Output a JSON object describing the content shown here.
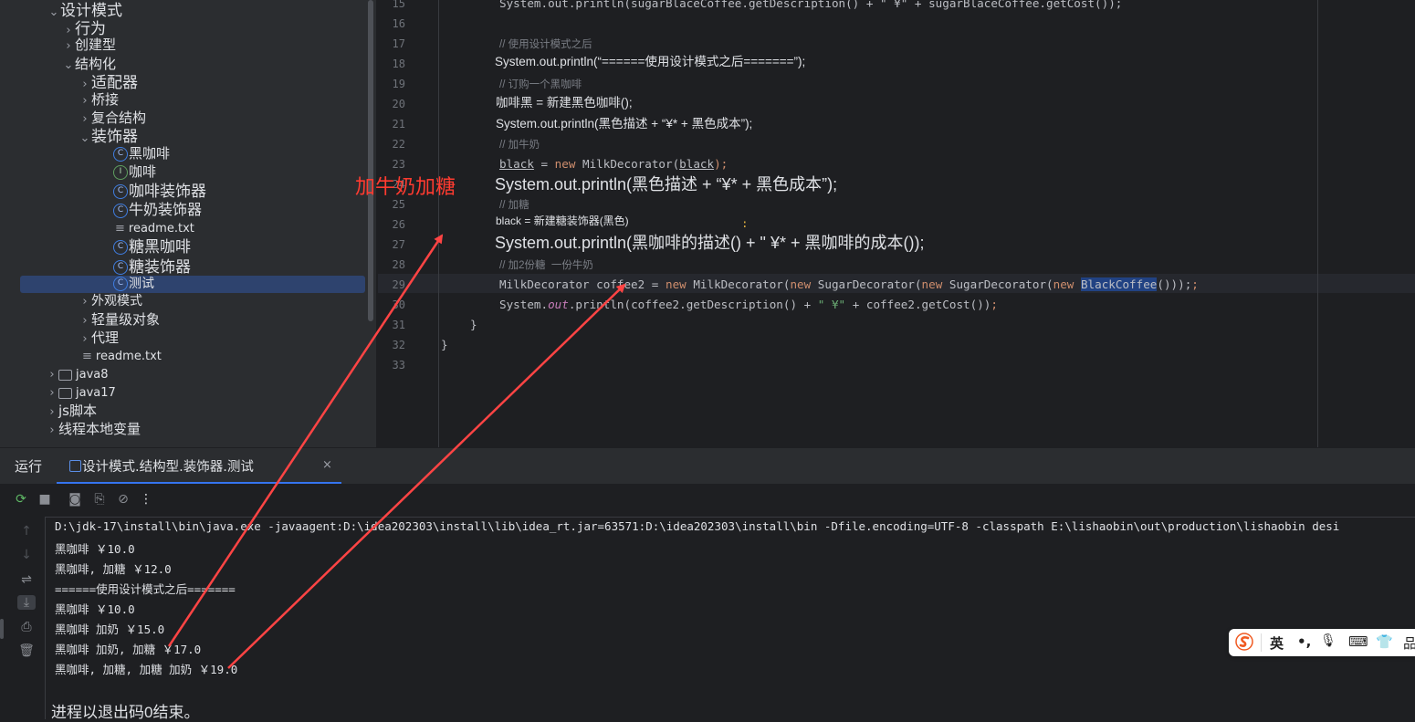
{
  "tree": {
    "items": [
      {
        "label": "设计模式",
        "chev": "⌄"
      },
      {
        "label": "行为",
        "chev": "›"
      },
      {
        "label": "创建型",
        "chev": "›"
      },
      {
        "label": "结构化",
        "chev": "⌄"
      },
      {
        "label": "适配器",
        "chev": "›"
      },
      {
        "label": "桥接",
        "chev": "›"
      },
      {
        "label": "复合结构",
        "chev": "›"
      },
      {
        "label": "装饰器",
        "chev": "⌄"
      },
      {
        "label": "黑咖啡",
        "icon": "class-icon"
      },
      {
        "label": "咖啡",
        "icon": "interface-icon"
      },
      {
        "label": "咖啡装饰器",
        "icon": "class-icon"
      },
      {
        "label": "牛奶装饰器",
        "icon": "class-icon"
      },
      {
        "label": "readme.txt",
        "icon": "text-file-icon"
      },
      {
        "label": "糖黑咖啡",
        "icon": "class-icon"
      },
      {
        "label": "糖装饰器",
        "icon": "class-icon"
      },
      {
        "label": "测试",
        "icon": "class-icon"
      },
      {
        "label": "外观模式",
        "chev": "›"
      },
      {
        "label": "轻量级对象",
        "chev": "›"
      },
      {
        "label": "代理",
        "chev": "›"
      },
      {
        "label": "readme.txt",
        "icon": "text-file-icon"
      },
      {
        "label": "java8",
        "chev": "›"
      },
      {
        "label": "java17",
        "chev": "›"
      },
      {
        "label": "js脚本",
        "chev": "›"
      },
      {
        "label": "线程本地变量",
        "chev": "›"
      }
    ],
    "class_glyph": "C",
    "interface_glyph": "I"
  },
  "editor": {
    "line_numbers": [
      "15",
      "16",
      "17",
      "18",
      "19",
      "20",
      "21",
      "22",
      "23",
      "24",
      "25",
      "26",
      "27",
      "28",
      "29",
      "30",
      "31",
      "32",
      "33"
    ],
    "line15": "System.out.println(sugarBlaceCoffee.getDescription() + \" ¥\" + sugarBlaceCoffee.getCost());",
    "line17": "// 使用设计模式之后",
    "line18": "System.out.println(“======使用设计模式之后=======”);",
    "line19": "// 订购一个黑咖啡",
    "line20": "咖啡黑 = 新建黑色咖啡();",
    "line21": "System.out.println(黑色描述 + “¥* + 黑色成本”);",
    "line22": "// 加牛奶",
    "line23_var": "black",
    "line23_eq": " = ",
    "line23_new": "new",
    "line23_cls": " MilkDecorator(",
    "line23_arg": "black",
    "line23_end": ");",
    "line24": "System.out.println(黑色描述 + “¥* + 黑色成本”);",
    "line25": "// 加糖",
    "line26": "black = 新建糖装饰器(黑色)",
    "line26_mark": ":",
    "line27": "System.out.println(黑咖啡的描述() + \" ¥* + 黑咖啡的成本());",
    "line28": "// 加2份糖  一份牛奶",
    "line29_a": "MilkDecorator coffee2 = ",
    "line29_new1": "new",
    "line29_b": " MilkDecorator(",
    "line29_new2": "new",
    "line29_c": " SugarDecorator(",
    "line29_new3": "new",
    "line29_d": " SugarDecorator(",
    "line29_new4": "new",
    "line29_sel": "BlackCoffee",
    "line29_end": "()));",
    "line29_semi": ";",
    "line30_a": "System.",
    "line30_out": "out",
    "line30_b": ".println(coffee2.getDescription() + ",
    "line30_str": "\" ¥\"",
    "line30_c": " + coffee2.getCost())",
    "line30_semi": ";",
    "line31": "}",
    "line32": "}"
  },
  "annotation": "加牛奶加糖",
  "run": {
    "label": "运行",
    "tab": "设计模式.结构型.装饰器.测试",
    "close": "×",
    "command": "D:\\jdk-17\\install\\bin\\java.exe -javaagent:D:\\idea202303\\install\\lib\\idea_rt.jar=63571:D:\\idea202303\\install\\bin -Dfile.encoding=UTF-8 -classpath E:\\lishaobin\\out\\production\\lishaobin desi",
    "output": [
      "黑咖啡 ￥10.0",
      "黑咖啡, 加糖 ￥12.0",
      "======使用设计模式之后=======",
      "黑咖啡 ￥10.0",
      "黑咖啡 加奶 ￥15.0",
      "黑咖啡 加奶, 加糖 ￥17.0",
      "黑咖啡, 加糖, 加糖 加奶 ￥19.0"
    ],
    "exit": "进程以退出码0结束。"
  },
  "ime": {
    "lang": "英",
    "punct": "•,",
    "mic": "🎙",
    "keyboard": "⌨",
    "skin": "👕",
    "more": "品"
  },
  "colors": {
    "annotation": "#ff3b30",
    "selection": "#2e436e",
    "keyword": "#cf8e6d"
  }
}
